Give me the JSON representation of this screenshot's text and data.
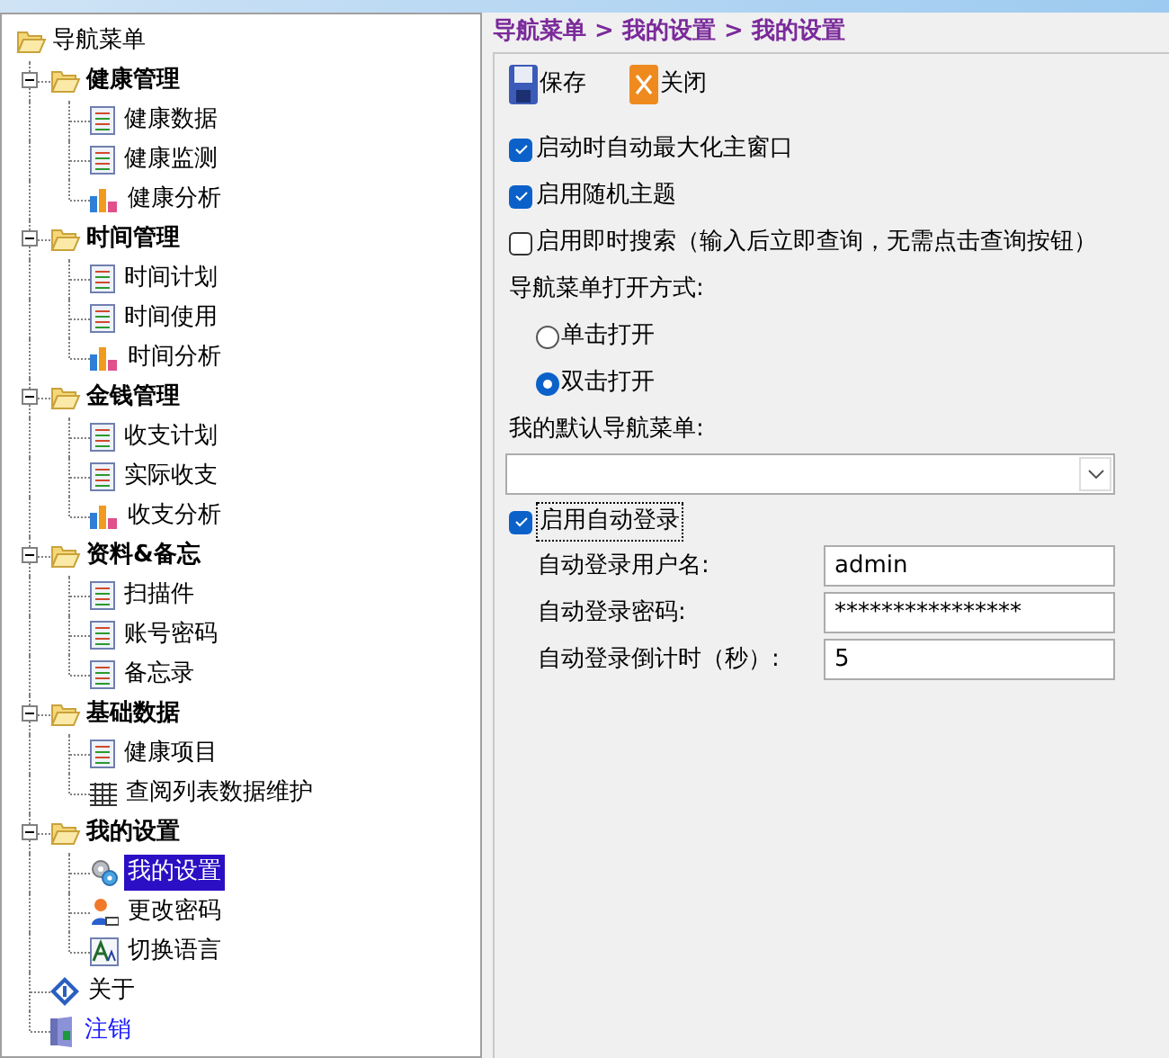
{
  "tree": {
    "label": "导航菜单",
    "children": [
      {
        "kind": "folder",
        "label": "健康管理",
        "expanded": true,
        "children": [
          {
            "kind": "doc",
            "label": "健康数据",
            "selected": false
          },
          {
            "kind": "doc",
            "label": "健康监测",
            "selected": false
          },
          {
            "kind": "chart",
            "label": "健康分析",
            "selected": false
          }
        ]
      },
      {
        "kind": "folder",
        "label": "时间管理",
        "expanded": true,
        "children": [
          {
            "kind": "doc",
            "label": "时间计划",
            "selected": false
          },
          {
            "kind": "doc",
            "label": "时间使用",
            "selected": false
          },
          {
            "kind": "chart",
            "label": "时间分析",
            "selected": false
          }
        ]
      },
      {
        "kind": "folder",
        "label": "金钱管理",
        "expanded": true,
        "children": [
          {
            "kind": "doc",
            "label": "收支计划",
            "selected": false
          },
          {
            "kind": "doc",
            "label": "实际收支",
            "selected": false
          },
          {
            "kind": "chart",
            "label": "收支分析",
            "selected": false
          }
        ]
      },
      {
        "kind": "folder",
        "label": "资料&备忘",
        "expanded": true,
        "children": [
          {
            "kind": "doc",
            "label": "扫描件",
            "selected": false
          },
          {
            "kind": "doc",
            "label": "账号密码",
            "selected": false
          },
          {
            "kind": "doc",
            "label": "备忘录",
            "selected": false
          }
        ]
      },
      {
        "kind": "folder",
        "label": "基础数据",
        "expanded": true,
        "children": [
          {
            "kind": "doc",
            "label": "健康项目",
            "selected": false
          },
          {
            "kind": "grid",
            "label": "查阅列表数据维护",
            "selected": false
          }
        ]
      },
      {
        "kind": "folder",
        "label": "我的设置",
        "expanded": true,
        "children": [
          {
            "kind": "gear",
            "label": "我的设置",
            "selected": true
          },
          {
            "kind": "user",
            "label": "更改密码",
            "selected": false
          },
          {
            "kind": "language",
            "label": "切换语言",
            "selected": false
          }
        ]
      },
      {
        "kind": "info",
        "label": "关于",
        "selected": false
      },
      {
        "kind": "logout",
        "label": "注销",
        "selected": false
      }
    ]
  },
  "breadcrumb": "导航菜单 > 我的设置 > 我的设置",
  "toolbar": [
    {
      "kind": "save",
      "label": "保存"
    },
    {
      "kind": "close",
      "label": "关闭"
    }
  ],
  "options": [
    {
      "label": "启动时自动最大化主窗口",
      "checked": true
    },
    {
      "label": "启用随机主题",
      "checked": true
    },
    {
      "label": "启用即时搜索（输入后立即查询，无需点击查询按钮）",
      "checked": false
    }
  ],
  "open_mode": {
    "label": "导航菜单打开方式:",
    "options": [
      {
        "label": "单击打开",
        "selected": false
      },
      {
        "label": "双击打开",
        "selected": true
      }
    ]
  },
  "default_menu": {
    "label": "我的默认导航菜单:"
  },
  "auto_login": {
    "label": "启用自动登录",
    "checked": true,
    "fields": [
      {
        "label": "自动登录用户名:",
        "value": "admin"
      },
      {
        "label": "自动登录密码:",
        "value": "****************"
      },
      {
        "label": "自动登录倒计时（秒）:",
        "value": "5"
      }
    ]
  }
}
